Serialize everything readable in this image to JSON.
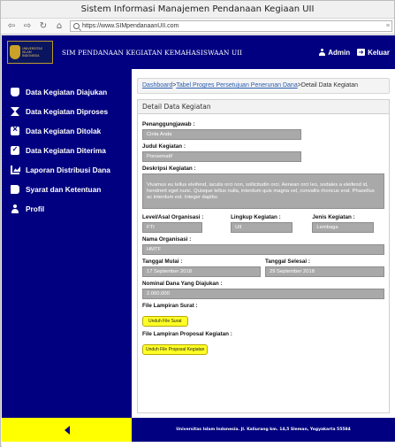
{
  "window": {
    "title": "Sistem Informasi Manajemen Pendanaan Kegiaan UII",
    "url": "https://www.SIMpendanaanUII.com"
  },
  "header": {
    "logo_text": [
      "UNIVERSITAS",
      "ISLAM",
      "INDONESIA"
    ],
    "app_title": "SIM PENDANAAN KEGIATAN KEMAHASISWAAN UII",
    "admin_label": "Admin",
    "logout_label": "Keluar"
  },
  "sidebar": {
    "items": [
      {
        "label": "Data Kegiatan Diajukan",
        "icon": "inbox-icon"
      },
      {
        "label": "Data Kegiatan Diproses",
        "icon": "hourglass-icon"
      },
      {
        "label": "Data Kegiatan Ditolak",
        "icon": "reject-icon"
      },
      {
        "label": "Data Kegiatan Diterima",
        "icon": "check-icon"
      },
      {
        "label": "Laporan Distribusi Dana",
        "icon": "area-chart-icon"
      },
      {
        "label": "Syarat dan Ketentuan",
        "icon": "book-icon"
      },
      {
        "label": "Profil",
        "icon": "user-icon"
      }
    ]
  },
  "breadcrumb": {
    "items": [
      "Dashboard",
      "Tabel Progres Persetujuan Penerunan Dana"
    ],
    "separator": ">",
    "current": "Detail Data Kegiatan"
  },
  "detail": {
    "panel_title": "Detail Data Kegiatan",
    "penanggungjawab": {
      "label": "Penanggungjawab :",
      "value": "Cinta Anda"
    },
    "judul": {
      "label": "Judul Kegiatan :",
      "value": "Ponsematif"
    },
    "deskripsi": {
      "label": "Deskripsi Kegiatan :",
      "value": "Vivamus eu tellus eleifend, iaculis orci non, sollicitudin orci. Aenean orci leo, sodales a eleifend id, hendrerit eget nunc. Quisque tellus nulla, interdum quis magna vel, convallis rhoncus erat. Phasellus ac interdum est. Integer dapibu"
    },
    "level": {
      "label": "Level/Asal Organisasi :",
      "value": "FTI"
    },
    "lingkup": {
      "label": "Lingkup Kegiatan :",
      "value": "UII"
    },
    "jenis": {
      "label": "Jenis Kegiatan :",
      "value": "Lembaga"
    },
    "organisasi": {
      "label": "Nama Organisasi :",
      "value": "HMTF"
    },
    "tanggal_mulai": {
      "label": "Tanggal Mulai :",
      "value": "17 September 2018"
    },
    "tanggal_selesai": {
      "label": "Tanggal Selesai :",
      "value": "29 September 2018"
    },
    "nominal": {
      "label": "Nominal Dana Yang Diajukan :",
      "value": "2.000.000"
    },
    "surat": {
      "label": "File Lampiran Surat :",
      "button": "Unduh File Surat"
    },
    "proposal": {
      "label": "File Lampiran Proposal Kegiatan :",
      "button": "Unduh File Proposal Kegiatan"
    }
  },
  "footer": {
    "address": "Universitas Islam Indonesia. Jl. Kaliurang km. 14,5 Sleman, Yogyakarta 55584"
  },
  "colors": {
    "primary": "#000080",
    "accent": "#ffff00",
    "field": "#a9a9a9"
  }
}
